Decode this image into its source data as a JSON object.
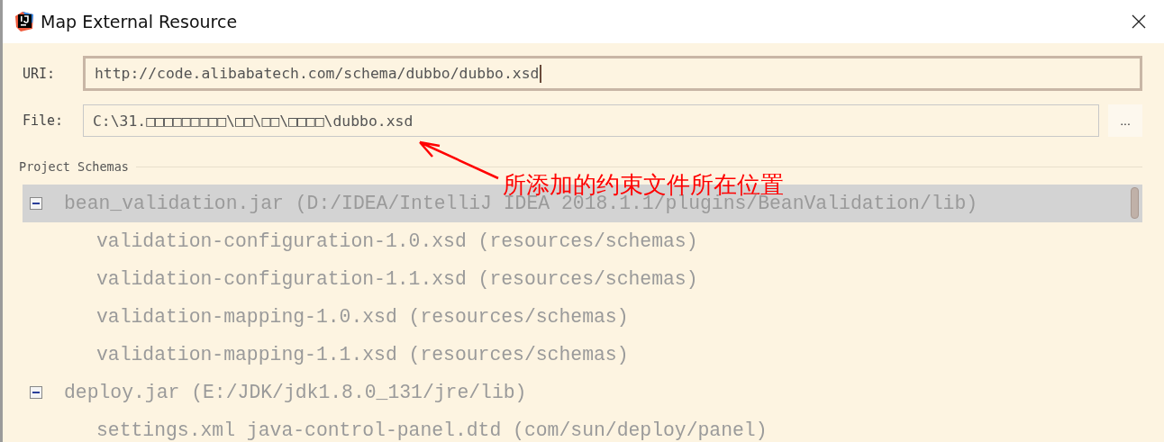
{
  "window": {
    "title": "Map External Resource"
  },
  "uri": {
    "label": "URI:",
    "value": "http://code.alibabatech.com/schema/dubbo/dubbo.xsd"
  },
  "file": {
    "label": "File:",
    "value": "C:\\31.□□□□□□□□□\\□□\\□□\\□□□□\\dubbo.xsd",
    "browse": "..."
  },
  "schemas": {
    "label": "Project Schemas",
    "tree": [
      {
        "name": "bean_validation.jar (D:/IDEA/IntelliJ IDEA 2018.1.1/plugins/BeanValidation/lib)",
        "expanded": true,
        "selected": true,
        "children": [
          {
            "name": "validation-configuration-1.0.xsd (resources/schemas)",
            "selected": false
          },
          {
            "name": "validation-configuration-1.1.xsd (resources/schemas)",
            "selected": false
          },
          {
            "name": "validation-mapping-1.0.xsd (resources/schemas)",
            "selected": false
          },
          {
            "name": "validation-mapping-1.1.xsd (resources/schemas)",
            "selected": false
          }
        ]
      },
      {
        "name": "deploy.jar (E:/JDK/jdk1.8.0_131/jre/lib)",
        "expanded": true,
        "selected": false,
        "children": [
          {
            "name": "settings.xml java-control-panel.dtd (com/sun/deploy/panel)",
            "selected": false
          }
        ]
      }
    ]
  },
  "annotation": {
    "text": "所添加的约束文件所在位置"
  }
}
